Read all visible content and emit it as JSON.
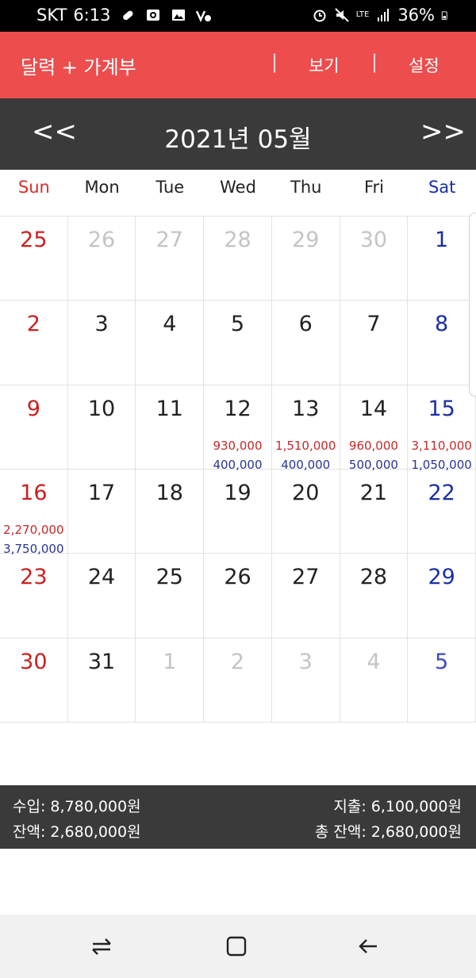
{
  "status_bar": {
    "carrier": "SKT",
    "time": "6:13",
    "network": "LTE",
    "battery": "36%",
    "icons": [
      "pill-icon",
      "camera-app-icon",
      "image-icon",
      "vowifi-icon",
      "alarm-icon",
      "mute-icon",
      "lte-icon",
      "signal-icon",
      "battery-icon"
    ]
  },
  "app_bar": {
    "title": "달력 + 가계부",
    "separator": "|",
    "view_label": "보기",
    "settings_label": "설정",
    "color": "#ee4d4d"
  },
  "month_header": {
    "prev": "<<",
    "title": "2021년 05월",
    "next": ">>"
  },
  "weekdays": [
    "Sun",
    "Mon",
    "Tue",
    "Wed",
    "Thu",
    "Fri",
    "Sat"
  ],
  "calendar": {
    "weeks": [
      [
        {
          "day": "25",
          "other": true
        },
        {
          "day": "26",
          "other": true
        },
        {
          "day": "27",
          "other": true
        },
        {
          "day": "28",
          "other": true
        },
        {
          "day": "29",
          "other": true
        },
        {
          "day": "30",
          "other": true
        },
        {
          "day": "1"
        }
      ],
      [
        {
          "day": "2"
        },
        {
          "day": "3"
        },
        {
          "day": "4"
        },
        {
          "day": "5"
        },
        {
          "day": "6"
        },
        {
          "day": "7"
        },
        {
          "day": "8"
        }
      ],
      [
        {
          "day": "9"
        },
        {
          "day": "10"
        },
        {
          "day": "11"
        },
        {
          "day": "12",
          "income": "930,000",
          "expense": "400,000"
        },
        {
          "day": "13",
          "income": "1,510,000",
          "expense": "400,000"
        },
        {
          "day": "14",
          "income": "960,000",
          "expense": "500,000"
        },
        {
          "day": "15",
          "income": "3,110,000",
          "expense": "1,050,000"
        }
      ],
      [
        {
          "day": "16",
          "income": "2,270,000",
          "expense": "3,750,000"
        },
        {
          "day": "17"
        },
        {
          "day": "18"
        },
        {
          "day": "19"
        },
        {
          "day": "20"
        },
        {
          "day": "21"
        },
        {
          "day": "22"
        }
      ],
      [
        {
          "day": "23"
        },
        {
          "day": "24"
        },
        {
          "day": "25"
        },
        {
          "day": "26"
        },
        {
          "day": "27"
        },
        {
          "day": "28"
        },
        {
          "day": "29"
        }
      ],
      [
        {
          "day": "30"
        },
        {
          "day": "31"
        },
        {
          "day": "1",
          "other": true
        },
        {
          "day": "2",
          "other": true
        },
        {
          "day": "3",
          "other": true
        },
        {
          "day": "4",
          "other": true
        },
        {
          "day": "5",
          "other": true
        }
      ]
    ],
    "income_color": "#c62828",
    "expense_color": "#283593"
  },
  "summary": {
    "income": "수입: 8,780,000원",
    "expense": "지출: 6,100,000원",
    "balance": "잔액: 2,680,000원",
    "total_balance": "총 잔액: 2,680,000원"
  },
  "nav_bar": {
    "icons": [
      "recent-apps-icon",
      "home-icon",
      "back-icon"
    ]
  }
}
